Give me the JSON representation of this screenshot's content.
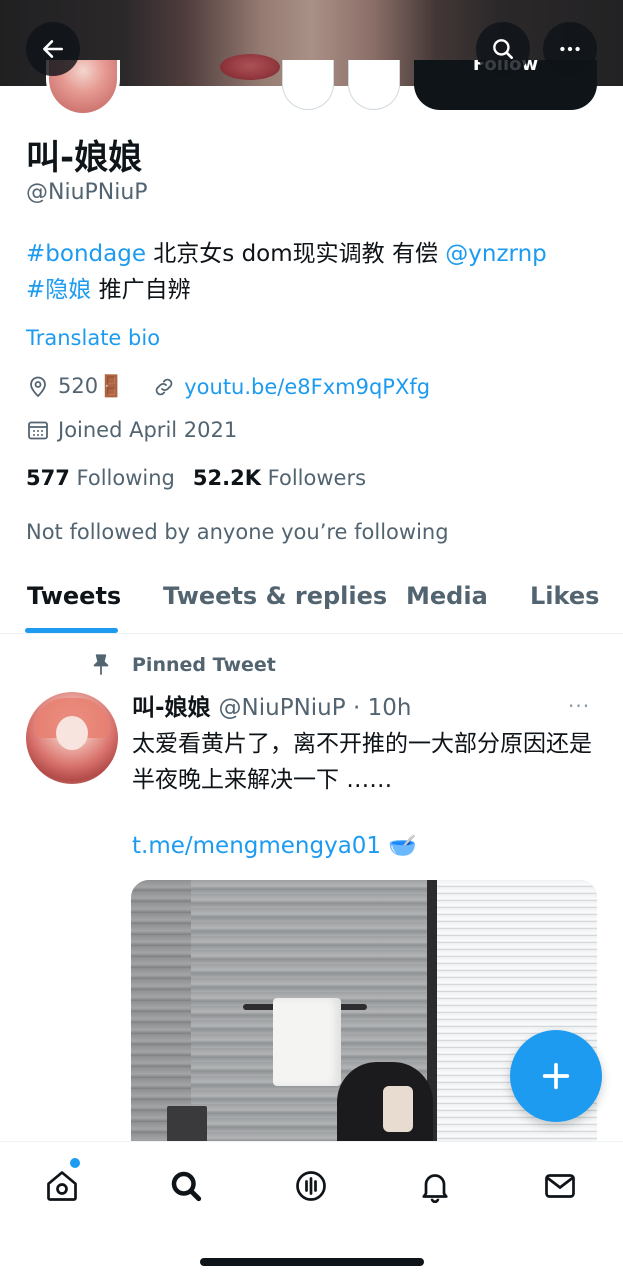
{
  "profile": {
    "name": "叫-娘娘",
    "handle": "@NiuPNiuP",
    "follow_label": "Follow",
    "bio": {
      "hashtag1": "#bondage",
      "text1": " 北京女s dom现实调教 有偿 ",
      "mention": "@ynzrnp",
      "hashtag2": "#隐娘",
      "text2": " 推广自辨"
    },
    "translate_label": "Translate bio",
    "location": "520🚪",
    "website": "youtu.be/e8Fxm9qPXfg",
    "joined": "Joined April 2021",
    "following_count": "577",
    "following_label": "Following",
    "followers_count": "52.2K",
    "followers_label": "Followers",
    "not_followed": "Not followed by anyone you’re following"
  },
  "tabs": [
    {
      "label": "Tweets",
      "active": true
    },
    {
      "label": "Tweets & replies",
      "active": false
    },
    {
      "label": "Media",
      "active": false
    },
    {
      "label": "Likes",
      "active": false
    }
  ],
  "tweet": {
    "pinned_label": "Pinned Tweet",
    "author_name": "叫-娘娘",
    "author_handle_time": "@NiuPNiuP · 10h",
    "more": "···",
    "text": "太爱看黄片了，离不开推的一大部分原因还是半夜晚上来解决一下 ……",
    "link": "t.me/mengmengya01 🥣"
  },
  "icons": {
    "back": "arrow-left-icon",
    "search": "search-icon",
    "more": "more-horizontal-icon",
    "location": "location-pin-icon",
    "link": "link-icon",
    "calendar": "calendar-icon",
    "pin": "pin-icon",
    "compose": "plus-icon"
  },
  "colors": {
    "accent": "#1d9bf0",
    "text": "#0f1419",
    "secondary": "#536471"
  }
}
